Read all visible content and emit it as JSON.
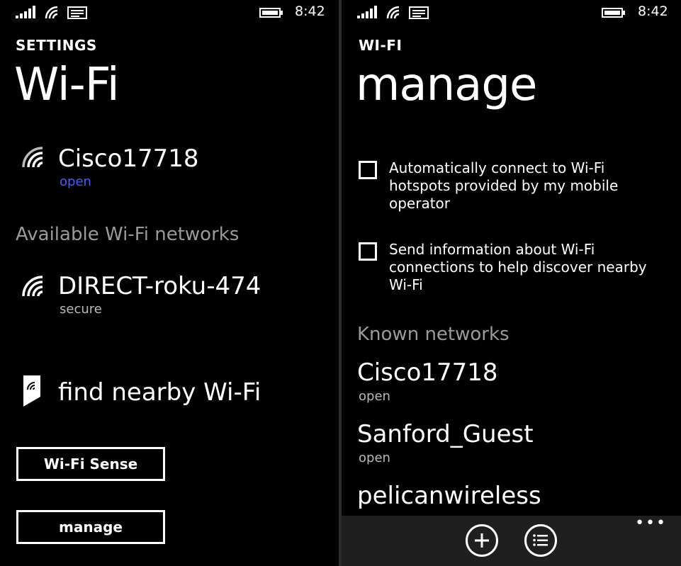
{
  "status": {
    "time": "8:42"
  },
  "left": {
    "settings_label": "SETTINGS",
    "title": "Wi-Fi",
    "connected": {
      "name": "Cisco17718",
      "status": "open"
    },
    "available_header": "Available Wi-Fi networks",
    "available": [
      {
        "name": "DIRECT-roku-474",
        "status": "secure"
      }
    ],
    "find_nearby": "find nearby Wi-Fi",
    "wifi_sense_button": "Wi-Fi Sense",
    "manage_button": "manage"
  },
  "right": {
    "section_label": "WI-FI",
    "title": "manage",
    "options": [
      {
        "text": "Automatically connect to Wi-Fi hotspots provided by my mobile operator",
        "checked": false
      },
      {
        "text": "Send information about Wi-Fi connections to help discover nearby Wi-Fi",
        "checked": false
      }
    ],
    "known_header": "Known networks",
    "known": [
      {
        "name": "Cisco17718",
        "status": "open"
      },
      {
        "name": "Sanford_Guest",
        "status": "open"
      },
      {
        "name": "pelicanwireless",
        "status": ""
      }
    ],
    "appbar": {
      "more": "•••"
    }
  },
  "icons": {
    "signal": "signal-bars-icon",
    "wifi": "wifi-icon",
    "message": "message-icon",
    "battery": "battery-icon",
    "add": "add-icon",
    "select": "select-list-icon",
    "find": "find-nearby-icon"
  },
  "colors": {
    "accent": "#4a5bff",
    "background": "#000000",
    "appbar": "#1f1f1f"
  }
}
